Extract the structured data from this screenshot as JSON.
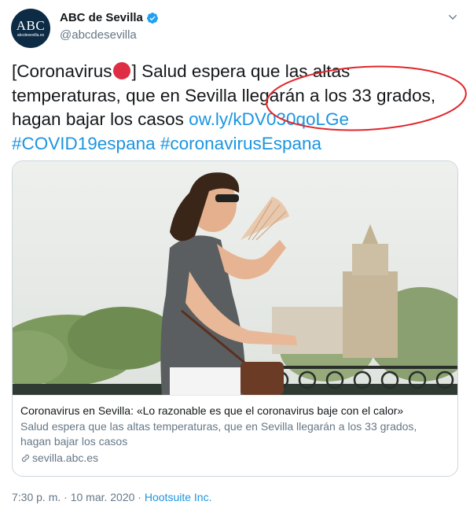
{
  "user": {
    "avatar_text": "ABC",
    "avatar_sub": "abcdesevilla.es",
    "name": "ABC de Sevilla",
    "handle": "@abcdesevilla"
  },
  "tweet": {
    "text_before_dot": "[Coronavirus",
    "text_after_dot": "]  Salud espera que las altas temperaturas, que en Sevilla llegarán a los 33 grados, hagan bajar los casos ",
    "link": "ow.ly/kDV030qoLGe",
    "hashtag1": "#COVID19espana",
    "hashtag2": "#coronavirusEspana"
  },
  "card": {
    "title": "Coronavirus en Sevilla: «Lo razonable es que el coronavirus baje con el calor»",
    "description": "Salud espera que las altas temperaturas, que en Sevilla llegarán a los 33 grados, hagan bajar los casos",
    "domain": "sevilla.abc.es"
  },
  "footer": {
    "time": "7:30 p. m. · 10 mar. 2020 · ",
    "source": "Hootsuite Inc."
  },
  "colors": {
    "link": "#1b95e0",
    "verified": "#1da1f2",
    "annotation": "#e0262b",
    "red_dot": "#dd2e44"
  },
  "icons": [
    "verified-badge-icon",
    "chevron-down-icon",
    "link-icon"
  ]
}
